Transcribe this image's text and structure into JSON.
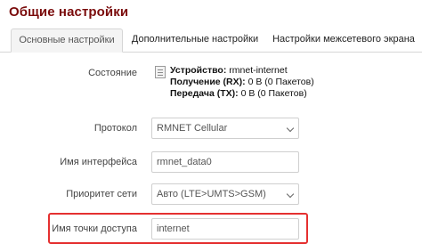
{
  "page": {
    "title": "Общие настройки"
  },
  "tabs": [
    {
      "label": "Основные настройки",
      "active": true
    },
    {
      "label": "Дополнительные настройки",
      "active": false
    },
    {
      "label": "Настройки межсетевого экрана",
      "active": false
    }
  ],
  "status": {
    "label": "Состояние",
    "icon": "interface-icon",
    "device_key": "Устройство:",
    "device_value": "rmnet-internet",
    "rx_key": "Получение (RX):",
    "rx_value": "0 B (0 Пакетов)",
    "tx_key": "Передача (TX):",
    "tx_value": "0 B (0 Пакетов)"
  },
  "protocol": {
    "label": "Протокол",
    "value": "RMNET Cellular"
  },
  "interface_name": {
    "label": "Имя интерфейса",
    "value": "rmnet_data0"
  },
  "network_priority": {
    "label": "Приоритет сети",
    "value": "Авто (LTE>UMTS>GSM)"
  },
  "apn": {
    "label": "Имя точки доступа",
    "value": "internet",
    "highlight_color": "#e53030"
  },
  "colors": {
    "title": "#7a0b0b",
    "active_tab_bg": "#f4f4f4",
    "border": "#cfcfcf"
  }
}
